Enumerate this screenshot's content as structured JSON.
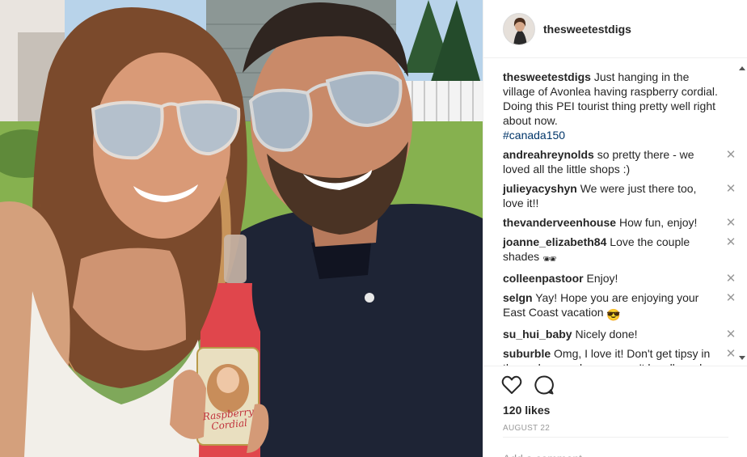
{
  "post": {
    "username": "thesweetestdigs",
    "caption_text": "Just hanging in the village of Avonlea having raspberry cordial. Doing this PEI tourist thing pretty well right about now.",
    "hashtag": "#canada150"
  },
  "photo": {
    "bottle_label_line1": "Raspberry",
    "bottle_label_line2": "Cordial"
  },
  "comments": [
    {
      "user": "andreahreynolds",
      "text": "so pretty there - we loved all the little shops :)"
    },
    {
      "user": "julieyacyshyn",
      "text": "We were just there too, love it!!"
    },
    {
      "user": "thevanderveenhouse",
      "text": "How fun, enjoy!"
    },
    {
      "user": "joanne_elizabeth84",
      "text": "Love the couple shades",
      "emoji": "🕶"
    },
    {
      "user": "colleenpastoor",
      "text": "Enjoy!"
    },
    {
      "user": "selgn",
      "text": "Yay! Hope you are enjoying your East Coast vacation",
      "emoji": "😎"
    },
    {
      "user": "su_hui_baby",
      "text": "Nicely done!"
    },
    {
      "user": "suburble",
      "text": "Omg, I love it! Don't get tipsy in the parlour or else you won't be allowed"
    }
  ],
  "comment_close_glyph": "✕",
  "likes": "120 likes",
  "date": "AUGUST 22",
  "add_comment_placeholder": "Add a comment...",
  "icons": {
    "like": "heart-icon",
    "comment": "speech-bubble-icon"
  },
  "colors": {
    "hashtag": "#003569",
    "muted": "#999999",
    "border": "#efefef"
  }
}
